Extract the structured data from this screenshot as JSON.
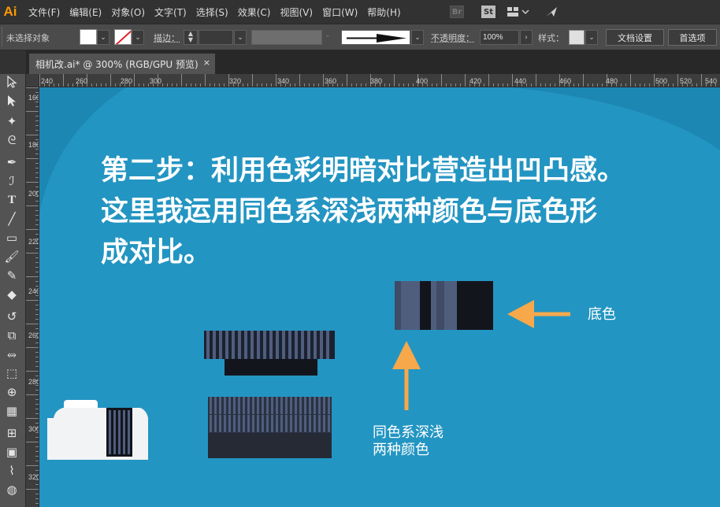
{
  "app": {
    "logo": "Ai"
  },
  "menu": [
    "文件(F)",
    "编辑(E)",
    "对象(O)",
    "文字(T)",
    "选择(S)",
    "效果(C)",
    "视图(V)",
    "窗口(W)",
    "帮助(H)"
  ],
  "menubar_icons": {
    "bridge": "Br",
    "stock": "St",
    "workspace": "workspace-switcher-icon",
    "sync": "sync-icon"
  },
  "control": {
    "selection_status": "未选择对象",
    "stroke_label": "描边：",
    "opacity_label": "不透明度：",
    "opacity_value": "100%",
    "style_label": "样式：",
    "doc_setup": "文档设置",
    "preferences": "首选项"
  },
  "tab": {
    "title": "相机改.ai* @ 300% (RGB/GPU 预览)",
    "close": "×"
  },
  "rulers": {
    "horizontal": [
      "240",
      "260",
      "280",
      "300",
      "320",
      "340",
      "360",
      "380",
      "400",
      "420",
      "440",
      "460",
      "480",
      "500",
      "520",
      "540"
    ],
    "vertical": [
      "160",
      "180",
      "200",
      "220",
      "240",
      "260",
      "280",
      "300",
      "320"
    ]
  },
  "canvas": {
    "background": "#2395c2",
    "heading": "第二步：利用色彩明暗对比营造出凹凸感。\n这里我运用同色系深浅两种颜色与底色形\n成对比。",
    "note_base": "底色",
    "note_shades": "同色系深浅\n两种颜色",
    "arrow_color": "#f7a84a",
    "swatch_colors": {
      "light": "#4f5e7d",
      "dark": "#13151d"
    }
  }
}
